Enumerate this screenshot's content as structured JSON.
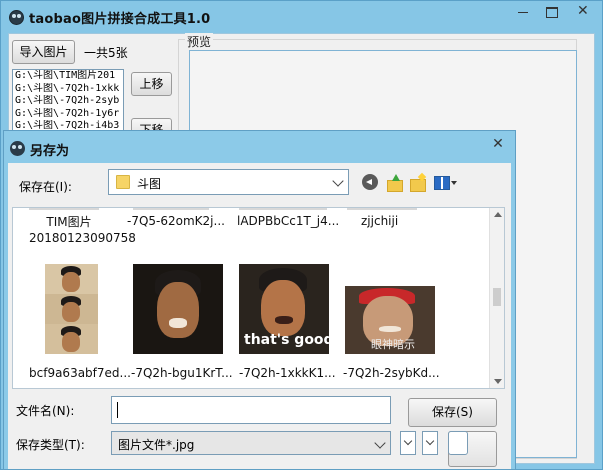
{
  "main": {
    "title": "taobao图片拼接合成工具1.0",
    "import_button": "导入图片",
    "total_count": "一共5张",
    "file_list": [
      "G:\\斗图\\TIM图片201",
      "G:\\斗图\\-7Q2h-1xkk",
      "G:\\斗图\\-7Q2h-2syb",
      "G:\\斗图\\-7Q2h-1y6r",
      "G:\\斗图\\-7Q2h-i4b3"
    ],
    "move_up_button": "上移",
    "move_down_button": "下移",
    "preview_label": "预览",
    "close_glyph": "✕"
  },
  "dialog": {
    "title": "另存为",
    "save_in_label": "保存在(I):",
    "save_in_value": "斗图",
    "close_glyph": "✕",
    "files_top_row": [
      "TIM图片\n20180123090758",
      "-7Q5-62omK2j...",
      "lADPBbCc1T_j4...",
      "zjjchiji"
    ],
    "files_bottom_row": [
      "bcf9a63abf7ed...",
      "-7Q2h-bgu1KrT...",
      "-7Q2h-1xkkK1...",
      "-7Q2h-2sybKd..."
    ],
    "thumb_captions": [
      "that's good",
      "眼神暗示"
    ],
    "filename_label": "文件名(N):",
    "filename_value": "",
    "filetype_label": "保存类型(T):",
    "filetype_value": "图片文件*.jpg",
    "save_button": "保存(S)"
  },
  "colors": {
    "titlebar": "#86c6e6",
    "window_bg": "#f0f0f0",
    "input_border": "#7a9cb5"
  }
}
